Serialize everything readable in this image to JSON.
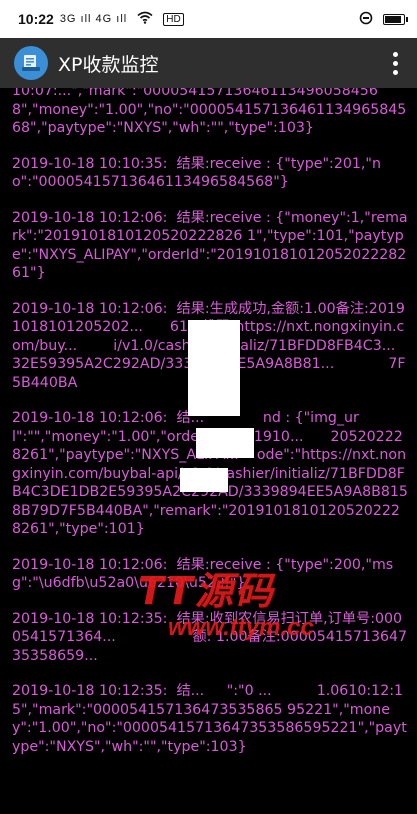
{
  "status_bar": {
    "time": "10:22",
    "signal_text": "3G ıll 4G ıll",
    "wifi_icon": "wifi-icon",
    "hd_label": "HD",
    "alarm_icon": "alarm-icon",
    "battery_icon": "battery-icon"
  },
  "app_bar": {
    "title": "XP收款监控",
    "app_icon": "app-logo-icon",
    "menu_icon": "more-vert-icon",
    "color": "#2f2f2f"
  },
  "log": {
    "text_color": "#d85bd8",
    "entries": [
      "10:07:...\",\"mark\":\"000054157136461134960584568\",\"money\":\"1.00\",\"no\":\"00005415713646113496584568\",\"paytype\":\"NXYS\",\"wh\":\"\",\"type\":103}",
      "2019-10-18 10:10:35:  结果:receive : {\"type\":201,\"no\":\"00005415713646113496584568\"}",
      "2019-10-18 10:12:06:  结果:receive : {\"money\":1,\"remark\":\"2019101810120520222826 1\",\"type\":101,\"paytype\":\"NXYS_ALIPAY\",\"orderId\":\"20191018101205202228261\"}",
      "2019-10-18 10:12:06:  结果:生成成功,金额:1.00备注:20191018101205202...      61二维码:https://nxt.nongxinyin.com/buy...        i/v1.0/cashier/initializ/71BFDD8FB4C3...          32E59395A2C292AD/3339894EE5A9A8B81...            7F5B440BA",
      "2019-10-18 10:12:06:  结...             nd : {\"img_url\":\"\",\"money\":\"1.00\",\"orderId\":\"201910...      205202228261\",\"paytype\":\"NXYS_ALIPA...    ode\":\"https://nxt.nongxinyin.com/buybal-api/v1.0/cashier/initializ/71BFDD8FB4C3DE1DB2E59395A2C292AD/3339894EE5A9A8B8158B79D7F5B440BA\",\"remark\":\"20191018101205202228261\",\"type\":101}",
      "2019-10-18 10:12:06:  结果:receive : {\"type\":200,\"msg\":\"\\u6dfb\\u52a0\\u6210\\u529f\"}",
      "2019-10-18 10:12:35:  结果:收到农信易扫订单,订单号:0000541571364...                 额: 1.00备注:0000541571364735358659...",
      "2019-10-18 10:12:35:  结...     \":\"0 ...          1.0610:12:15\",\"mark\":\"000054157136473535865 95221\",\"money\":\"1.00\",\"no\":\"00005415713647353586595221\",\"paytype\":\"NXYS\",\"wh\":\"\",\"type\":103}"
    ]
  },
  "watermark": {
    "text": "TT源码",
    "url": "www.ttym.cc"
  }
}
